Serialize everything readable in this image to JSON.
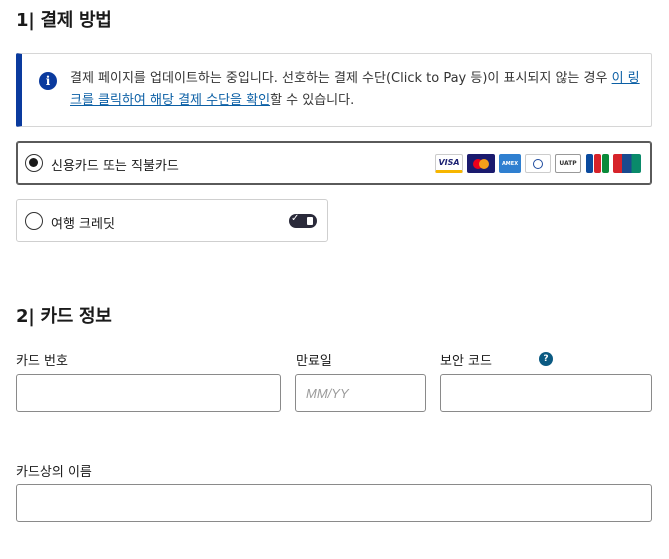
{
  "section1": {
    "number": "1|",
    "title": "결제 방법"
  },
  "notice": {
    "text_before": "결제 페이지를 업데이트하는 중입니다. 선호하는 결제 수단(Click to Pay 등)이 표시되지 않는 경우 ",
    "link_text": "이 링크를 클릭하여 해당 결제 수단을 확인",
    "text_after": "할 수 있습니다."
  },
  "payment_options": [
    {
      "label": "신용카드 또는 직불카드",
      "selected": true
    },
    {
      "label": "여행 크레딧",
      "selected": false
    }
  ],
  "card_logos": [
    "VISA",
    "Mastercard",
    "AMEX",
    "Diners Club",
    "UATP",
    "JCB",
    "UnionPay"
  ],
  "section2": {
    "number": "2|",
    "title": "카드 정보"
  },
  "fields": {
    "card_number": {
      "label": "카드 번호",
      "value": ""
    },
    "expiry": {
      "label": "만료일",
      "placeholder": "MM/YY",
      "value": ""
    },
    "cvv": {
      "label": "보안 코드",
      "value": ""
    },
    "cardholder": {
      "label": "카드상의 이름",
      "value": ""
    }
  },
  "colors": {
    "accent": "#0a3a9e",
    "link": "#0b5fa5",
    "help": "#0b5a82"
  }
}
